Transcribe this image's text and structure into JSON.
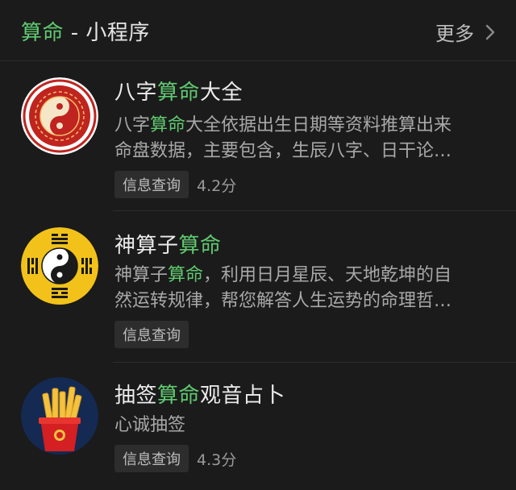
{
  "header": {
    "title_hl": "算命",
    "title_rest": " - 小程序",
    "more_label": "更多"
  },
  "items": [
    {
      "title_pre": "八字",
      "title_hl": "算命",
      "title_post": "大全",
      "desc_line1_pre": "八字",
      "desc_line1_hl": "算命",
      "desc_line1_post": "大全依据出生日期等资料推算出来",
      "desc_line2": "命盘数据，主要包含，生辰八字、日干论…",
      "tag": "信息查询",
      "score": "4.2分",
      "icon": "yin-yang-red-seal-icon"
    },
    {
      "title_pre": "神算子",
      "title_hl": "算命",
      "title_post": "",
      "desc_line1_pre": "神算子",
      "desc_line1_hl": "算命",
      "desc_line1_post": "，利用日月星辰、天地乾坤的自",
      "desc_line2": "然运转规律，帮您解答人生运势的命理哲…",
      "tag": "信息查询",
      "score": "",
      "icon": "bagua-yin-yang-icon"
    },
    {
      "title_pre": "抽签",
      "title_hl": "算命",
      "title_post": "观音占卜",
      "desc_line1_pre": "心诚抽签",
      "desc_line1_hl": "",
      "desc_line1_post": "",
      "desc_line2": "",
      "tag": "信息查询",
      "score": "4.3分",
      "icon": "fortune-sticks-icon"
    }
  ],
  "colors": {
    "background": "#1b1b1b",
    "highlight": "#5fc96f",
    "text": "#ececec",
    "secondary": "#a8a8a8",
    "tag_bg": "#2d2d2d"
  }
}
